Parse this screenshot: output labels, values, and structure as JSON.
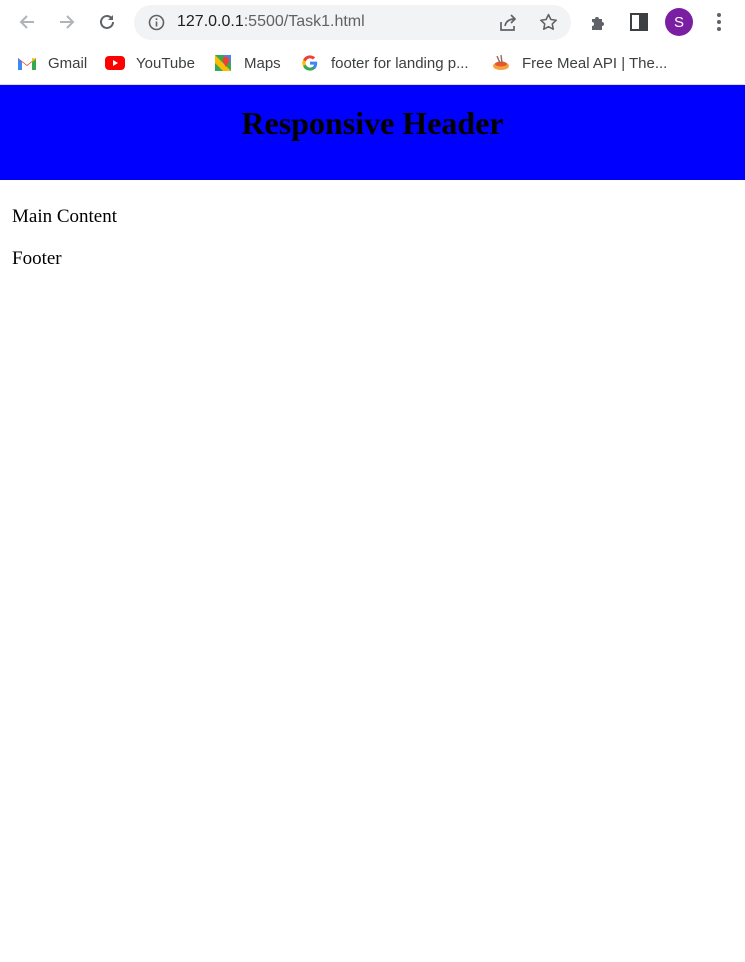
{
  "browser": {
    "url_host": "127.0.0.1",
    "url_rest": ":5500/Task1.html",
    "profile_initial": "S",
    "profile_color": "#7b1fa2"
  },
  "bookmarks": [
    {
      "label": "Gmail",
      "icon": "gmail-icon"
    },
    {
      "label": "YouTube",
      "icon": "youtube-icon"
    },
    {
      "label": "Maps",
      "icon": "maps-icon"
    },
    {
      "label": "footer for landing p...",
      "icon": "google-icon"
    },
    {
      "label": "Free Meal API | The...",
      "icon": "meal-api-icon"
    }
  ],
  "page": {
    "header_title": "Responsive Header",
    "header_bg": "#0000ff",
    "main_text": "Main Content",
    "footer_text": "Footer"
  }
}
